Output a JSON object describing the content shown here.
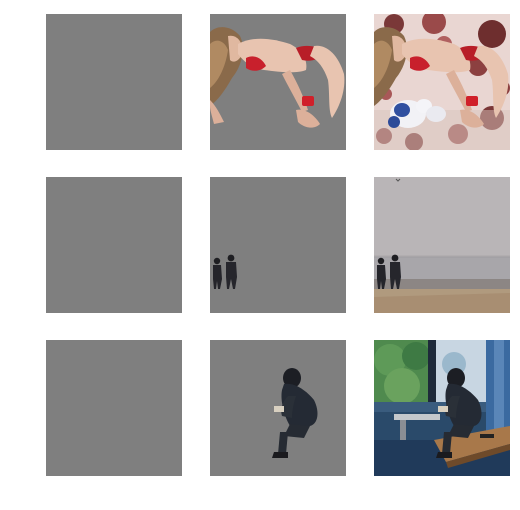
{
  "colors": {
    "page_background": "#ffffff",
    "blank_tile": "#7f7f7f",
    "mask_background": "#7f7f7f"
  },
  "grid": {
    "rows": [
      {
        "subject": "woman-on-bed",
        "tiles": [
          {
            "kind": "blank",
            "icon": "blank-tile"
          },
          {
            "kind": "mask",
            "icon": "segmented-figure"
          },
          {
            "kind": "photo",
            "icon": "photo-scene"
          }
        ]
      },
      {
        "subject": "two-people-walking-on-seafront",
        "tiles": [
          {
            "kind": "blank",
            "icon": "blank-tile"
          },
          {
            "kind": "mask",
            "icon": "segmented-figures"
          },
          {
            "kind": "photo",
            "icon": "photo-scene"
          }
        ]
      },
      {
        "subject": "person-sitting-by-window",
        "tiles": [
          {
            "kind": "blank",
            "icon": "blank-tile"
          },
          {
            "kind": "mask",
            "icon": "segmented-figure"
          },
          {
            "kind": "photo",
            "icon": "photo-scene"
          }
        ]
      }
    ]
  }
}
